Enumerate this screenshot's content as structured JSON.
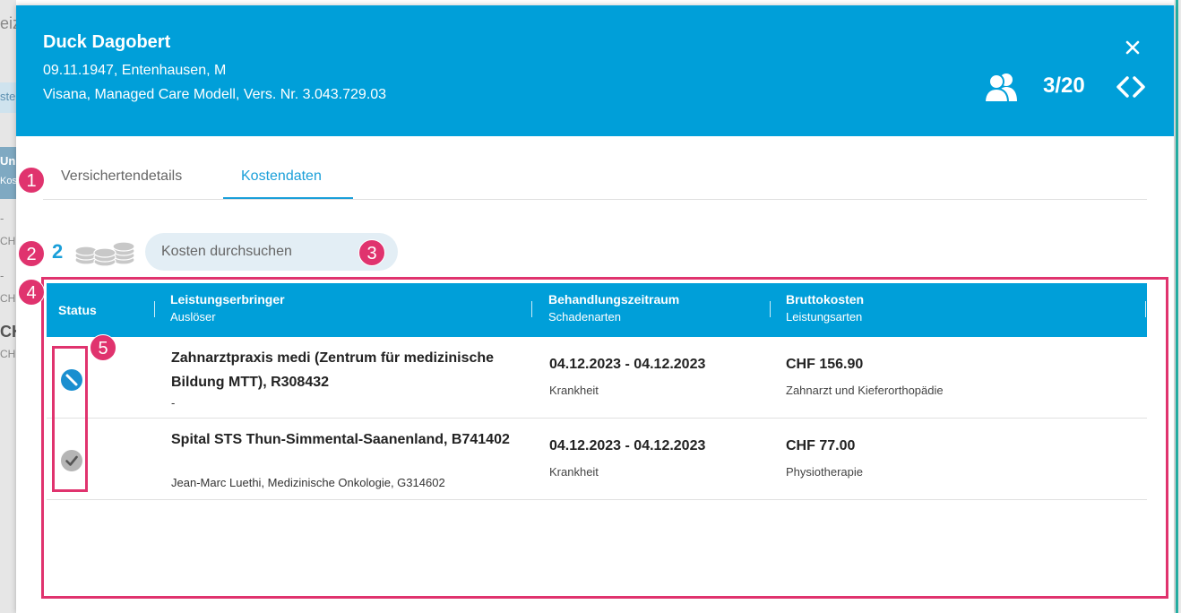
{
  "header": {
    "name": "Duck Dagobert",
    "details_line1": "09.11.1947, Entenhausen, M",
    "details_line2": "Visana, Managed Care Modell, Vers. Nr. 3.043.729.03",
    "counter": "3/20",
    "icons": {
      "close": "close-icon",
      "users": "users-icon",
      "nav": "chevron-left-right-icon"
    }
  },
  "tabs": [
    {
      "label": "Versichertendetails",
      "active": false
    },
    {
      "label": "Kostendaten",
      "active": true
    }
  ],
  "toolbar": {
    "count": "2",
    "coins_icon": "coins-icon",
    "search_placeholder": "Kosten durchsuchen"
  },
  "table": {
    "columns": [
      {
        "label": "Status",
        "sub": ""
      },
      {
        "label": "Leistungserbringer",
        "sub": "Auslöser"
      },
      {
        "label": "Behandlungszeitraum",
        "sub": "Schadenarten"
      },
      {
        "label": "Bruttokosten",
        "sub": "Leistungsarten"
      }
    ],
    "rows": [
      {
        "status_icon": "blocked-icon",
        "provider": "Zahnarztpraxis medi (Zentrum für medizinische Bildung MTT), R308432",
        "trigger": "-",
        "period": "04.12.2023 - 04.12.2023",
        "damage_type": "Krankheit",
        "gross_cost": "CHF 156.90",
        "service_type": "Zahnarzt und Kieferorthopädie"
      },
      {
        "status_icon": "check-icon",
        "provider": "Spital STS Thun-Simmental-Saanenland, B741402",
        "trigger": "Jean-Marc Luethi, Medizinische Onkologie, G314602",
        "period": "04.12.2023 - 04.12.2023",
        "damage_type": "Krankheit",
        "gross_cost": "CHF 77.00",
        "service_type": "Physiotherapie"
      }
    ]
  },
  "annotations": [
    "1",
    "2",
    "3",
    "4",
    "5"
  ],
  "background": {
    "fragments": [
      "eiz",
      "ste",
      "Un",
      "Kos",
      "-",
      "CHI",
      "-",
      "CHI",
      "CH",
      "CHF"
    ]
  },
  "colors": {
    "primary": "#009fd9",
    "accent_annotation": "#e0336e",
    "search_bg": "#e3eef5"
  }
}
